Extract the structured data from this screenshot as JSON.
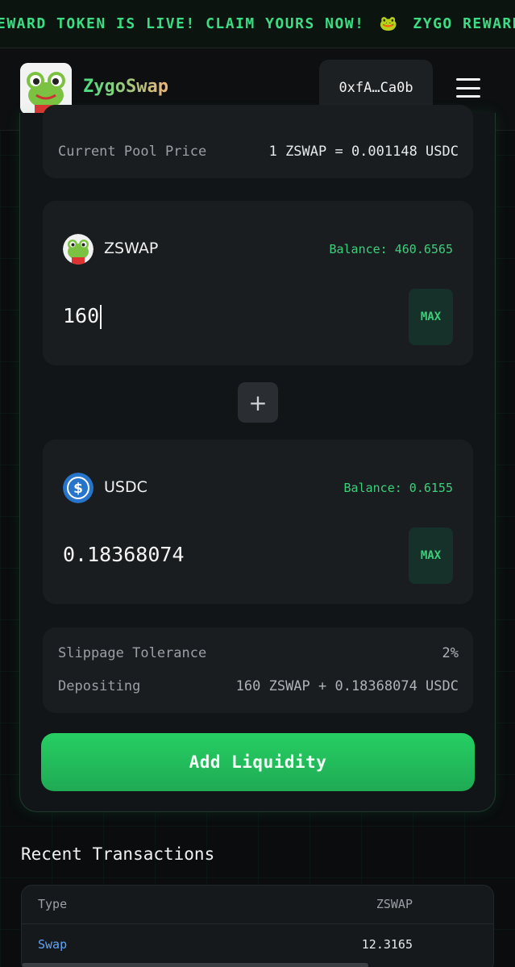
{
  "ticker": {
    "text_a": "EWARD TOKEN IS LIVE! CLAIM YOURS NOW!",
    "frog_icon": "frog-icon",
    "text_b": "ZYGO REWARD"
  },
  "header": {
    "brand": "ZygoSwap",
    "wallet": "0xfA…Ca0b",
    "menu_icon": "hamburger-menu-icon"
  },
  "pool": {
    "label": "Current Pool Price",
    "value": "1 ZSWAP = 0.001148 USDC"
  },
  "token_a": {
    "symbol": "ZSWAP",
    "balance": "Balance: 460.6565",
    "amount": "160",
    "max": "MAX"
  },
  "token_b": {
    "symbol": "USDC",
    "balance": "Balance: 0.6155",
    "amount": "0.18368074",
    "max": "MAX"
  },
  "summary": {
    "slippage_label": "Slippage Tolerance",
    "slippage_value": "2%",
    "depositing_label": "Depositing",
    "depositing_value": "160 ZSWAP + 0.18368074 USDC"
  },
  "actions": {
    "add_liquidity": "Add Liquidity"
  },
  "recent": {
    "title": "Recent Transactions",
    "columns": [
      "Type",
      "ZSWAP"
    ],
    "rows": [
      {
        "type": "Swap",
        "amount": "12.3165"
      }
    ]
  },
  "colors": {
    "accent": "#22c55e",
    "link": "#60a5fa",
    "background": "#0a0c0e"
  }
}
